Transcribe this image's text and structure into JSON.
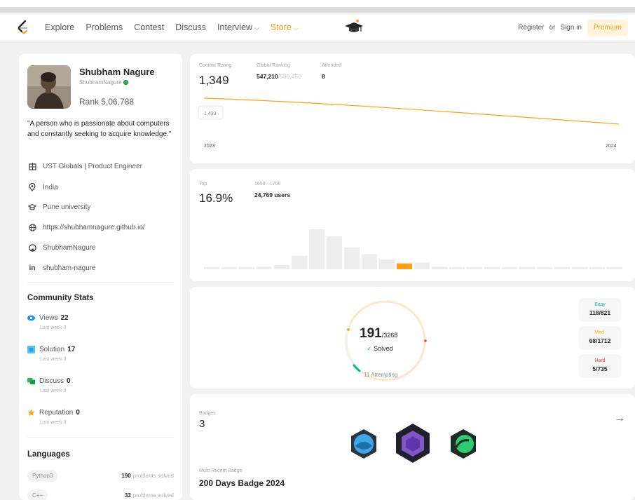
{
  "nav": {
    "links": [
      "Explore",
      "Problems",
      "Contest",
      "Discuss",
      "Interview",
      "Store"
    ],
    "register": "Register",
    "or": "or",
    "signin": "Sign in",
    "premium": "Premium"
  },
  "profile": {
    "name": "Shubham Nagure",
    "handle": "ShubhamNagure",
    "rank": "Rank 5,06,788",
    "bio": "\"A person who is passionate about computers and constantly seeking to acquire knowledge.\"",
    "company": "UST Globals | Product Engineer",
    "location": "India",
    "school": "Pune university",
    "website": "https://shubhamnagure.github.io/",
    "github": "ShubhamNagure",
    "linkedin": "shubham-nagure"
  },
  "community": {
    "title": "Community Stats",
    "items": [
      {
        "label": "Views",
        "value": "22",
        "sub": "Last week 0",
        "color": "#1e90ff"
      },
      {
        "label": "Solution",
        "value": "17",
        "sub": "Last week 0",
        "color": "#4fc3f7"
      },
      {
        "label": "Discuss",
        "value": "0",
        "sub": "Last week 0",
        "color": "#2cbb5d"
      },
      {
        "label": "Reputation",
        "value": "0",
        "sub": "Last week 0",
        "color": "#ffa116"
      }
    ]
  },
  "languages": {
    "title": "Languages",
    "items": [
      {
        "name": "Python3",
        "count": "190",
        "suffix": "problems solved"
      },
      {
        "name": "C++",
        "count": "33",
        "suffix": "problems solved"
      }
    ]
  },
  "contest": {
    "rating_label": "Contest Rating",
    "rating": "1,349",
    "global_label": "Global Ranking",
    "global_rank": "547,210",
    "global_total": "/580,450",
    "attended_label": "Attended",
    "attended": "8",
    "tooltip": "1,433",
    "year_start": "2023",
    "year_end": "2024"
  },
  "chart_data": {
    "type": "line",
    "x": [
      "2023",
      "2024"
    ],
    "series": [
      {
        "values": [
          1433,
          1349
        ]
      }
    ]
  },
  "top": {
    "label": "Top",
    "value": "16.9%",
    "range": "1650 - 1700",
    "users": "24,769 users",
    "bars": [
      0.05,
      0.05,
      0.05,
      0.06,
      0.1,
      0.32,
      0.95,
      0.78,
      0.52,
      0.36,
      0.23,
      0.14,
      0.16,
      0.06,
      0.05,
      0.05,
      0.05,
      0.05,
      0.05,
      0.05,
      0.05,
      0.05,
      0.05,
      0.05
    ],
    "highlight": 11
  },
  "solved": {
    "count": "191",
    "total": "/3268",
    "label": "Solved",
    "attempting": "11 Attempting",
    "easy_label": "Easy",
    "easy": "118/821",
    "medium_label": "Med.",
    "medium": "68/1712",
    "hard_label": "Hard",
    "hard": "5/735",
    "fraction_solved": 0.058
  },
  "badges": {
    "label": "Badges",
    "count": "3",
    "recent_label": "Most Recent Badge",
    "recent": "200 Days Badge 2024"
  },
  "colors": {
    "brand": "#ffa116",
    "easy": "#00b8a3",
    "medium": "#ffb800",
    "hard": "#ef4743"
  }
}
